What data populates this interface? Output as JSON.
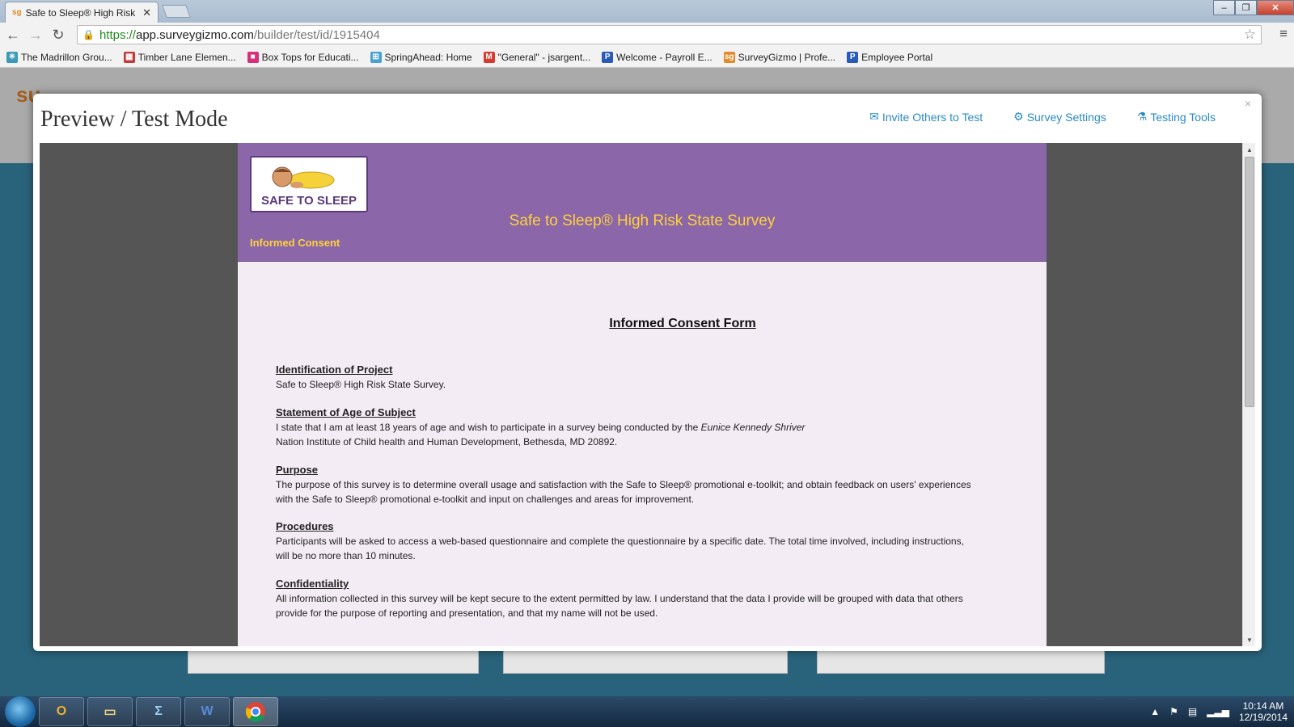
{
  "browser": {
    "tab_title": "Safe to Sleep® High Risk",
    "tab_favicon": "sg",
    "url_scheme": "https://",
    "url_host": "app.surveygizmo.com",
    "url_path": "/builder/test/id/1915404"
  },
  "bookmarks": [
    {
      "label": "The Madrillon Grou...",
      "icon": "star-icon",
      "color": "#3a9ab8"
    },
    {
      "label": "Timber Lane Elemen...",
      "icon": "school-icon",
      "color": "#c23a3a"
    },
    {
      "label": "Box Tops for Educati...",
      "icon": "box-icon",
      "color": "#d6307a"
    },
    {
      "label": "SpringAhead: Home",
      "icon": "grid-icon",
      "color": "#4aa0d0"
    },
    {
      "label": "\"General\" - jsargent...",
      "icon": "gmail-icon",
      "color": "#d93a2e"
    },
    {
      "label": "Welcome - Payroll E...",
      "icon": "p-icon",
      "color": "#2a5ab8"
    },
    {
      "label": "SurveyGizmo | Profe...",
      "icon": "sg-icon",
      "color": "#e28a2a"
    },
    {
      "label": "Employee Portal",
      "icon": "p-icon",
      "color": "#2a5ab8"
    }
  ],
  "modal": {
    "title": "Preview / Test Mode",
    "actions": {
      "invite": "Invite Others to Test",
      "settings": "Survey Settings",
      "testing": "Testing Tools"
    },
    "close": "×"
  },
  "survey": {
    "logo_text": "SAFE TO SLEEP",
    "title": "Safe to Sleep® High Risk State Survey",
    "page_name": "Informed Consent",
    "form_heading": "Informed Consent Form",
    "sections": [
      {
        "heading": "Identification of Project",
        "text": "Safe to Sleep® High Risk State Survey."
      },
      {
        "heading": "Statement of Age of Subject",
        "text_before": "I state that I am at least 18 years of age and wish to participate in a survey being conducted by the ",
        "text_italic": "Eunice Kennedy Shriver",
        "text_after": "Nation Institute of Child health and Human Development, Bethesda, MD 20892."
      },
      {
        "heading": "Purpose",
        "text": "The purpose of this survey is to determine overall usage and satisfaction with the Safe to Sleep® promotional e-toolkit; and obtain feedback on users' experiences with the Safe to Sleep® promotional e-toolkit and input on challenges and areas for improvement."
      },
      {
        "heading": "Procedures",
        "text": "Participants will be asked to access a web-based questionnaire and complete the questionnaire by a specific date. The total time involved, including instructions, will be no more than 10 minutes."
      },
      {
        "heading": "Confidentiality",
        "text": "All information collected in this survey will be kept secure to the extent permitted by law. I understand that the data I provide will be grouped with data that others provide for the purpose of reporting and presentation, and that my name will not be used."
      }
    ]
  },
  "taskbar": {
    "apps": [
      "Outlook",
      "Explorer",
      "Calculator",
      "Word",
      "Chrome"
    ],
    "time": "10:14 AM",
    "date": "12/19/2014"
  }
}
